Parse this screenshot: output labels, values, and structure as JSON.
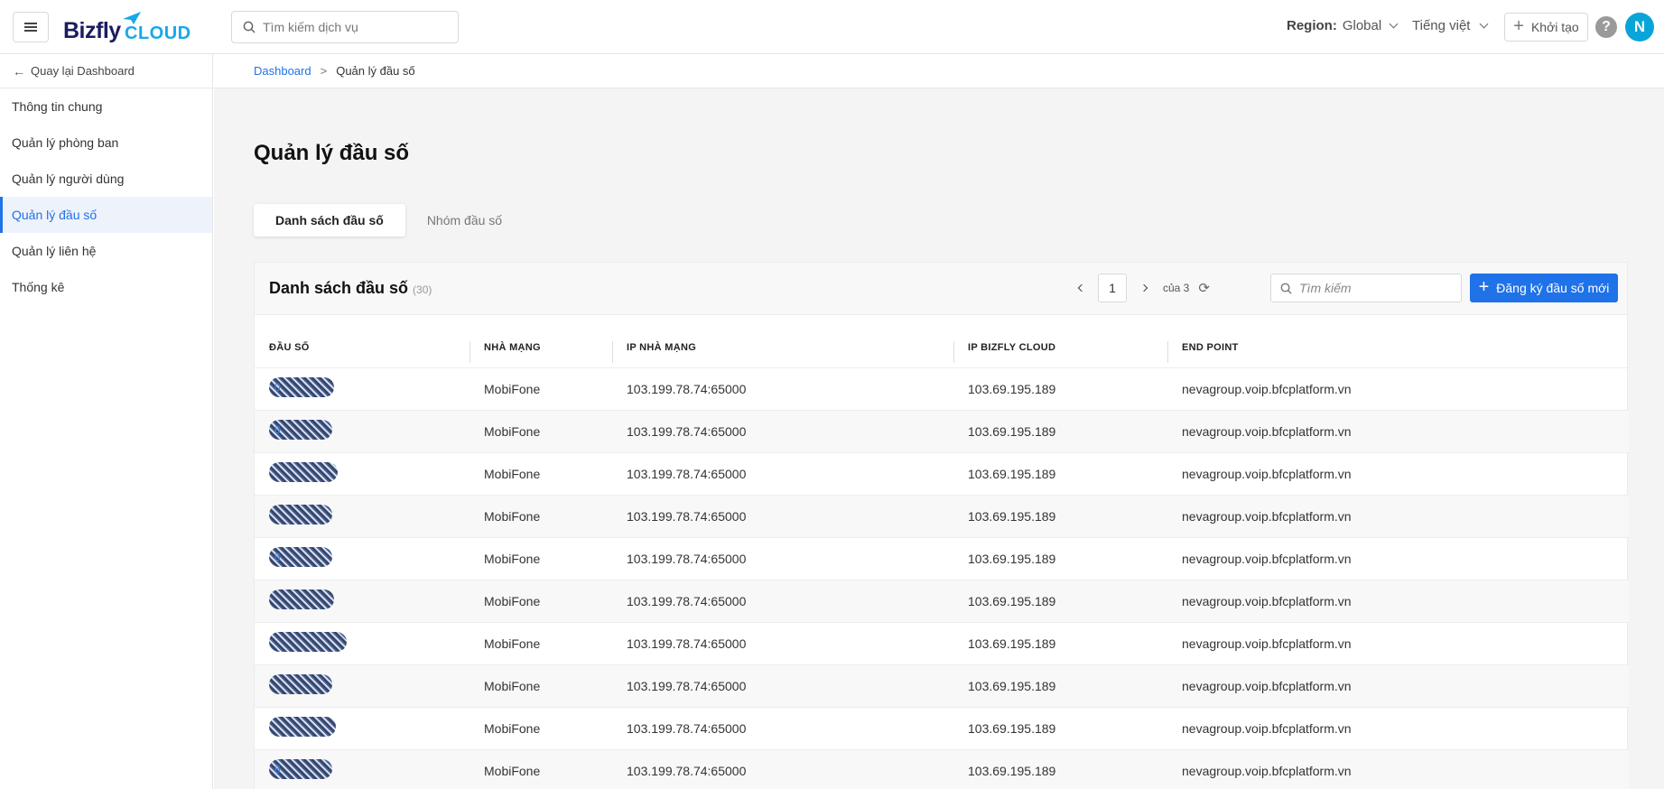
{
  "header": {
    "logo_primary": "Bizfly",
    "logo_secondary": "CLOUD",
    "search_placeholder": "Tìm kiếm dịch vụ",
    "region_label": "Region:",
    "region_value": "Global",
    "language": "Tiếng việt",
    "create_label": "Khởi tạo",
    "help_glyph": "?",
    "avatar_initial": "N"
  },
  "sidebar": {
    "back_label": "Quay lại Dashboard",
    "items": [
      {
        "label": "Thông tin chung",
        "active": false
      },
      {
        "label": "Quản lý phòng ban",
        "active": false
      },
      {
        "label": "Quản lý người dùng",
        "active": false
      },
      {
        "label": "Quản lý đầu số",
        "active": true
      },
      {
        "label": "Quản lý liên hệ",
        "active": false
      },
      {
        "label": "Thống kê",
        "active": false
      }
    ]
  },
  "breadcrumb": {
    "root": "Dashboard",
    "separator": ">",
    "current": "Quản lý đầu số"
  },
  "page": {
    "title": "Quản lý đầu số",
    "tabs": [
      {
        "label": "Danh sách đầu số",
        "active": true
      },
      {
        "label": "Nhóm đầu số",
        "active": false
      }
    ]
  },
  "card": {
    "title": "Danh sách đầu số",
    "count": "(30)",
    "pager": {
      "current": "1",
      "of_label": "của 3"
    },
    "search_placeholder": "Tìm kiếm",
    "register_label": "Đăng ký đầu số mới"
  },
  "table": {
    "columns": [
      "ĐẦU SỐ",
      "NHÀ MẠNG",
      "IP NHÀ MẠNG",
      "IP BIZFLY CLOUD",
      "END POINT"
    ],
    "rows": [
      {
        "phone": "0",
        "carrier": "MobiFone",
        "ip_carrier": "103.199.78.74:65000",
        "ip_bizfly": "103.69.195.189",
        "endpoint": "nevagroup.voip.bfcplatform.vn"
      },
      {
        "phone": "6",
        "carrier": "MobiFone",
        "ip_carrier": "103.199.78.74:65000",
        "ip_bizfly": "103.69.195.189",
        "endpoint": "nevagroup.voip.bfcplatform.vn"
      },
      {
        "phone": "",
        "carrier": "MobiFone",
        "ip_carrier": "103.199.78.74:65000",
        "ip_bizfly": "103.69.195.189",
        "endpoint": "nevagroup.voip.bfcplatform.vn"
      },
      {
        "phone": "",
        "carrier": "MobiFone",
        "ip_carrier": "103.199.78.74:65000",
        "ip_bizfly": "103.69.195.189",
        "endpoint": "nevagroup.voip.bfcplatform.vn"
      },
      {
        "phone": "6",
        "carrier": "MobiFone",
        "ip_carrier": "103.199.78.74:65000",
        "ip_bizfly": "103.69.195.189",
        "endpoint": "nevagroup.voip.bfcplatform.vn"
      },
      {
        "phone": "",
        "carrier": "MobiFone",
        "ip_carrier": "103.199.78.74:65000",
        "ip_bizfly": "103.69.195.189",
        "endpoint": "nevagroup.voip.bfcplatform.vn"
      },
      {
        "phone": "",
        "carrier": "MobiFone",
        "ip_carrier": "103.199.78.74:65000",
        "ip_bizfly": "103.69.195.189",
        "endpoint": "nevagroup.voip.bfcplatform.vn"
      },
      {
        "phone": "",
        "carrier": "MobiFone",
        "ip_carrier": "103.199.78.74:65000",
        "ip_bizfly": "103.69.195.189",
        "endpoint": "nevagroup.voip.bfcplatform.vn"
      },
      {
        "phone": "",
        "carrier": "MobiFone",
        "ip_carrier": "103.199.78.74:65000",
        "ip_bizfly": "103.69.195.189",
        "endpoint": "nevagroup.voip.bfcplatform.vn"
      },
      {
        "phone": "6",
        "carrier": "MobiFone",
        "ip_carrier": "103.199.78.74:65000",
        "ip_bizfly": "103.69.195.189",
        "endpoint": "nevagroup.voip.bfcplatform.vn"
      }
    ]
  },
  "colors": {
    "accent": "#1f72e8",
    "avatar_bg": "#0aa5d8",
    "logo_dark": "#1c1c5e",
    "logo_light": "#16a9e8"
  }
}
